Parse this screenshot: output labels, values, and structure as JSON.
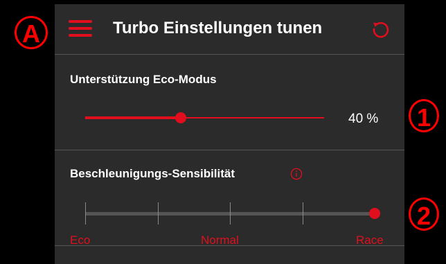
{
  "header": {
    "menu_icon": "hamburger-menu-icon",
    "title": "Turbo Einstellungen tunen",
    "reset_icon": "reset-icon"
  },
  "eco_assist": {
    "label": "Unterstützung Eco-Modus",
    "value_percent": 40,
    "value_text": "40 %"
  },
  "acceleration": {
    "label": "Beschleunigungs-Sensibilität",
    "info_icon": "info-icon",
    "steps": 5,
    "selected_step": 4,
    "labels": {
      "eco": "Eco",
      "normal": "Normal",
      "race": "Race"
    }
  },
  "annotations": {
    "a": "A",
    "one": "1",
    "two": "2"
  },
  "colors": {
    "accent": "#e10f1e",
    "background": "#2b2b2b",
    "annotation": "#ff0000"
  }
}
